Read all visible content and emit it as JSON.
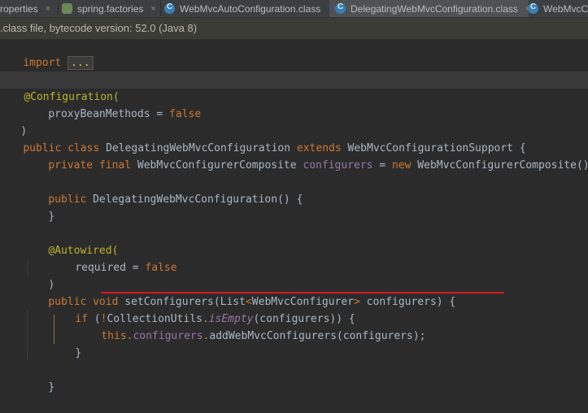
{
  "tabs": [
    {
      "label": "roperties",
      "icon": "properties-file-icon",
      "active": false
    },
    {
      "label": "spring.factories",
      "icon": "spring-icon",
      "active": false
    },
    {
      "label": "WebMvcAutoConfiguration.class",
      "icon": "class-file-icon",
      "active": false
    },
    {
      "label": "DelegatingWebMvcConfiguration.class",
      "icon": "class-file-icon",
      "active": true
    },
    {
      "label": "WebMvcCo",
      "icon": "class-file-icon",
      "active": false
    }
  ],
  "close_glyph": "×",
  "notice": ".class file, bytecode version: 52.0 (Java 8)",
  "code": {
    "import_kw": "import",
    "import_fold": "...",
    "config_ann": "@Configuration(",
    "proxy_attr": "proxyBeanMethods",
    "eq": " = ",
    "false_kw": "false",
    "close_paren": ")",
    "public_kw": "public",
    "class_kw": "class",
    "class_name": "DelegatingWebMvcConfiguration",
    "extends_kw": "extends",
    "super_name": "WebMvcConfigurationSupport",
    "open_brace": " {",
    "private_kw": "private",
    "final_kw": "final",
    "field_type": "WebMvcConfigurerComposite",
    "field_name": "configurers",
    "new_kw": "new",
    "ctor_call": "WebMvcConfigurerComposite();",
    "ctor_decl": "DelegatingWebMvcConfiguration() {",
    "close_brace": "}",
    "autowired_ann": "@Autowired(",
    "required_attr": "required",
    "void_kw": "void",
    "method_name": "setConfigurers",
    "list_type": "(List",
    "lt": "<",
    "generic_type": "WebMvcConfigurer",
    "gt": ">",
    "param_name": " configurers) {",
    "if_kw": "if",
    "not_op": "!",
    "util_class": "CollectionUtils",
    "dot": ".",
    "is_empty": "isEmpty",
    "if_args": "(configurers)) {",
    "this_kw": "this",
    "field_ref": "configurers",
    "add_call": "addWebMvcConfigurers(configurers);",
    "semicolon": ";",
    "paren_open": "(",
    "space": " "
  }
}
